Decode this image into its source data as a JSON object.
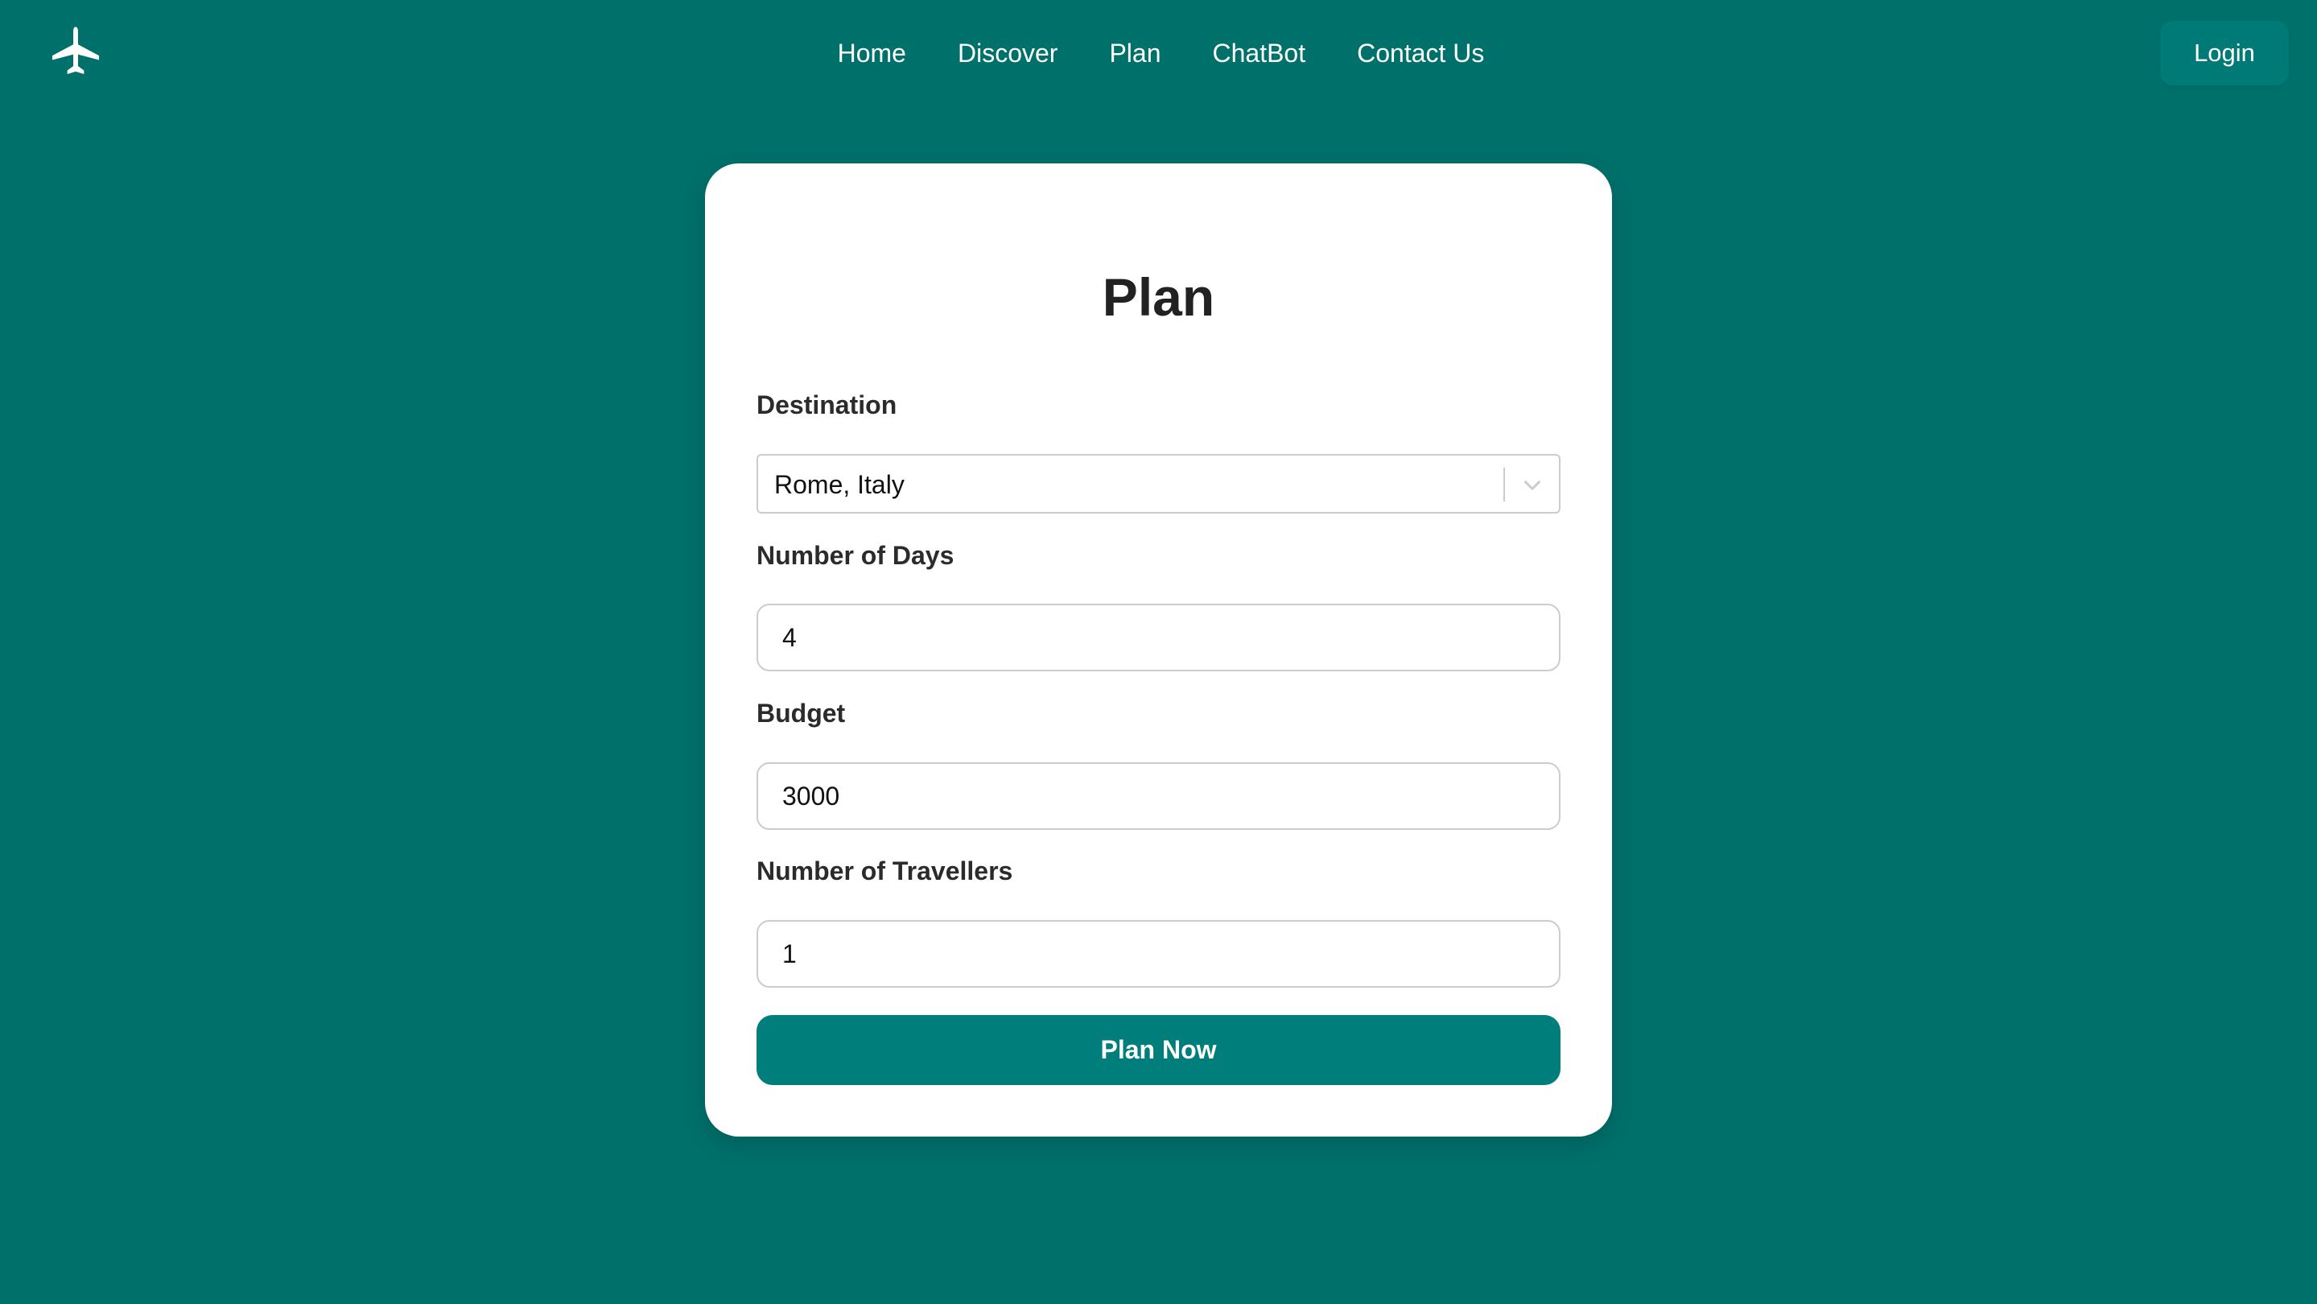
{
  "header": {
    "logo_icon": "airplane-icon",
    "nav": [
      {
        "label": "Home"
      },
      {
        "label": "Discover"
      },
      {
        "label": "Plan"
      },
      {
        "label": "ChatBot"
      },
      {
        "label": "Contact Us"
      }
    ],
    "login_label": "Login"
  },
  "form": {
    "title": "Plan",
    "destination": {
      "label": "Destination",
      "value": "Rome, Italy",
      "icon": "chevron-down-icon"
    },
    "days": {
      "label": "Number of Days",
      "value": "4"
    },
    "budget": {
      "label": "Budget",
      "value": "3000"
    },
    "travellers": {
      "label": "Number of Travellers",
      "value": "1"
    },
    "submit_label": "Plan Now"
  },
  "colors": {
    "background": "#00706b",
    "accent": "#007e7c",
    "card": "#ffffff"
  }
}
